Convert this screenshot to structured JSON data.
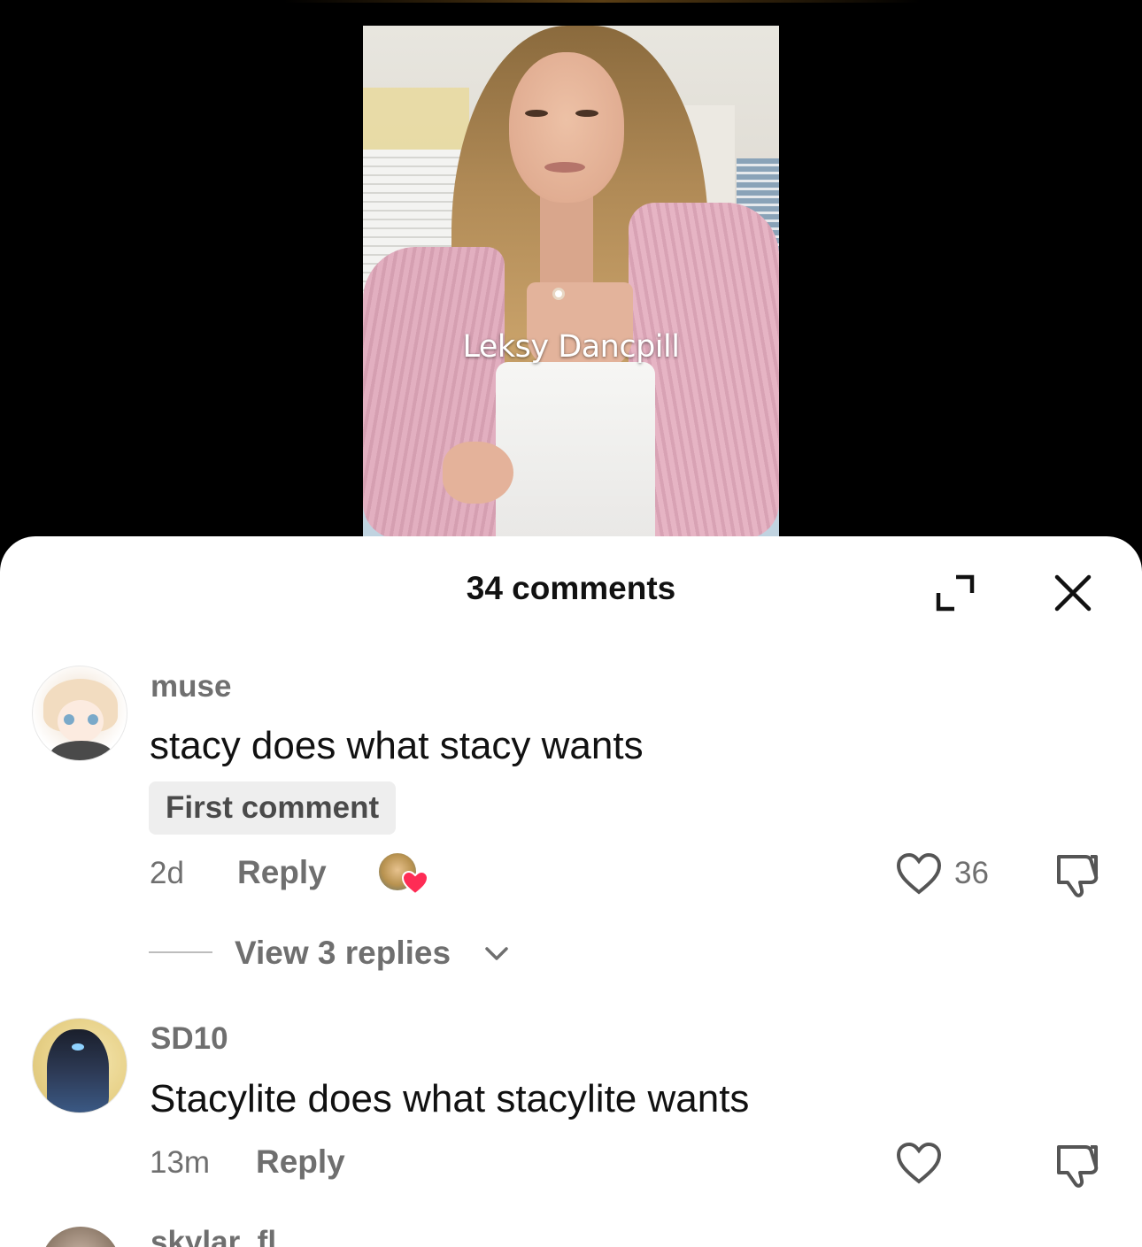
{
  "video": {
    "caption": "Leksy Dancpill"
  },
  "sheet": {
    "title": "34 comments"
  },
  "comments": [
    {
      "username": "muse",
      "text": "stacy does what stacy wants",
      "badge": "First comment",
      "time": "2d",
      "reply_label": "Reply",
      "liked_by_creator": true,
      "likes": "36",
      "view_replies_label": "View 3 replies"
    },
    {
      "username": "SD10",
      "text": "Stacylite does what stacylite wants",
      "time": "13m",
      "reply_label": "Reply"
    },
    {
      "username": "skylar_fl"
    }
  ],
  "icons": {
    "expand": "expand-icon",
    "close": "close-icon",
    "like": "heart-outline-icon",
    "dislike": "thumbs-down-icon",
    "chevron": "chevron-down-icon",
    "creator_like": "heart-filled-icon"
  },
  "colors": {
    "accent_red": "#fe2c55",
    "muted_text": "#6f6f6f"
  }
}
